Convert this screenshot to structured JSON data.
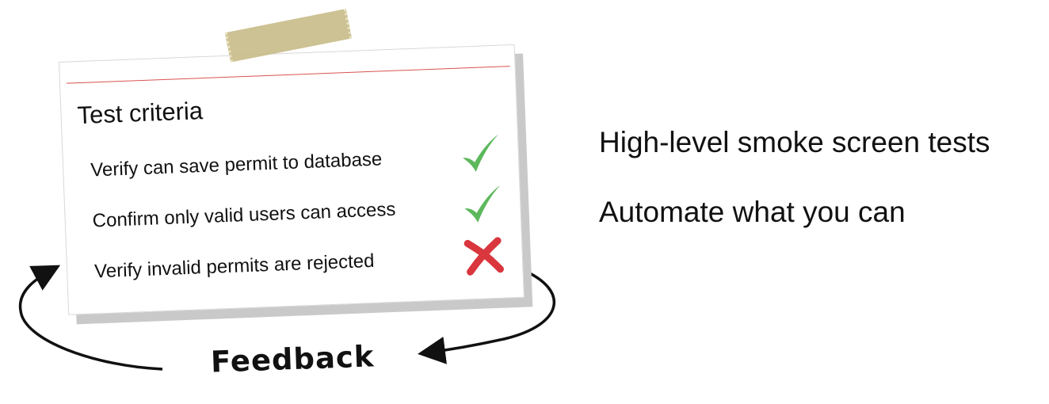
{
  "card": {
    "title": "Test criteria",
    "criteria": [
      {
        "text": "Verify can save permit to database",
        "status": "pass",
        "mark_icon": "check-icon"
      },
      {
        "text": "Confirm only valid users can access",
        "status": "pass",
        "mark_icon": "check-icon"
      },
      {
        "text": "Verify invalid permits are rejected",
        "status": "fail",
        "mark_icon": "cross-icon"
      }
    ]
  },
  "points": [
    "High-level smoke screen tests",
    "Automate what you can"
  ],
  "feedback_label": "Feedback",
  "colors": {
    "pass": "#5cb85c",
    "fail": "#d9363e",
    "card_line": "#d9534f",
    "tape": "#c9bd8a"
  }
}
